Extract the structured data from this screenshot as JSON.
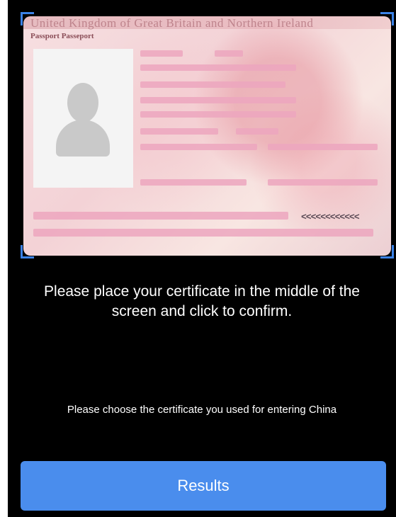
{
  "camera": {
    "passport_header": "United Kingdom of Great Britain and Northern Ireland",
    "passport_type": "Passport Passeport",
    "photo_icon": "person-silhouette-icon",
    "mrz_tail": "<<<<<<<<<<<<"
  },
  "instruction": "Please place your certificate in the middle of the screen and click to confirm.",
  "choose_prompt": "Please choose the certificate you used for entering China",
  "results_button": "Results",
  "colors": {
    "frame_corner": "#3b82e6",
    "button": "#4a8ded",
    "background": "#000000",
    "redaction": "#eca6be"
  }
}
